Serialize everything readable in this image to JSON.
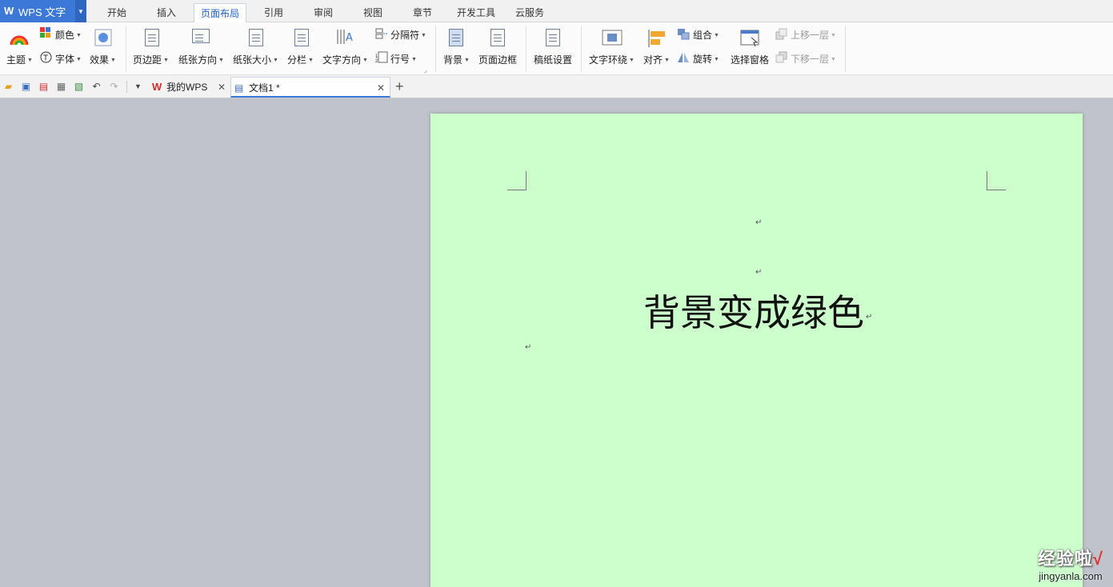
{
  "app": {
    "title": "WPS 文字"
  },
  "menu_tabs": [
    "开始",
    "插入",
    "页面布局",
    "引用",
    "审阅",
    "视图",
    "章节",
    "开发工具",
    "云服务"
  ],
  "active_tab": "页面布局",
  "ribbon": {
    "color": "颜色",
    "theme": "主题",
    "font": "字体",
    "effect": "效果",
    "margins": "页边距",
    "orientation": "纸张方向",
    "size": "纸张大小",
    "columns": "分栏",
    "text_direction": "文字方向",
    "breaks": "分隔符",
    "line_numbers": "行号",
    "background": "背景",
    "page_border": "页面边框",
    "grid_paper": "稿纸设置",
    "wrap_text": "文字环绕",
    "align": "对齐",
    "group": "组合",
    "rotate": "旋转",
    "selection_pane": "选择窗格",
    "bring_forward": "上移一层",
    "send_backward": "下移一层"
  },
  "doc_tabs": [
    {
      "label": "我的WPS",
      "active": false
    },
    {
      "label": "文档1 *",
      "active": true
    }
  ],
  "document": {
    "background_color": "#ccffcc",
    "text": "背景变成绿色",
    "paragraph_mark": "↵"
  },
  "watermark": {
    "line1": "经验啦",
    "check": "√",
    "line2": "jingyanla.com"
  }
}
